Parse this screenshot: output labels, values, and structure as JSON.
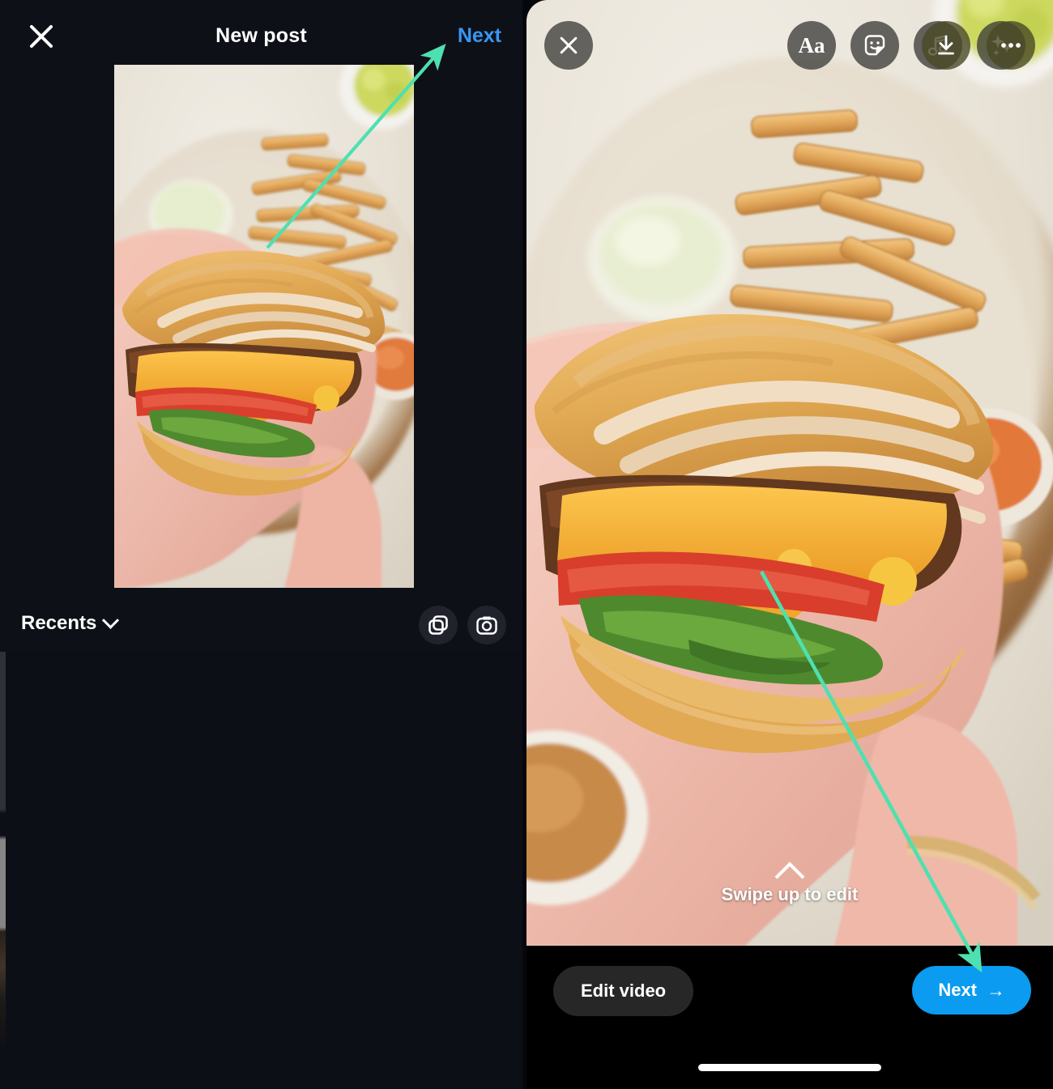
{
  "left_panel": {
    "header": {
      "close_icon": "close-icon",
      "title": "New post",
      "next_label": "Next"
    },
    "gallery": {
      "album_label": "Recents",
      "chevron_icon": "chevron-down-icon",
      "multi_select_icon": "multi-select-icon",
      "camera_icon": "camera-icon"
    }
  },
  "right_panel": {
    "toolbar": {
      "close_icon": "close-icon",
      "text_label": "Aa",
      "text_icon": "text-tool-icon",
      "sticker_icon": "sticker-icon",
      "music_icon": "music-note-icon",
      "effects_icon": "sparkles-icon",
      "download_icon": "download-icon",
      "more_icon": "more-options-icon"
    },
    "overlay": {
      "swipe_chevron_icon": "chevron-up-icon",
      "swipe_hint": "Swipe up to edit"
    },
    "bottom_bar": {
      "edit_video_label": "Edit video",
      "next_label": "Next",
      "next_arrow_icon": "arrow-right-icon",
      "home_indicator": "home-indicator"
    }
  },
  "annotations": {
    "color": "#4ee0b0",
    "arrow_1": "points to Next link in left panel header",
    "arrow_2": "points to Next button in right panel bottom bar"
  },
  "colors": {
    "panel_bg": "#0e1018",
    "accent_blue": "#3897f0",
    "next_button_blue": "#0b9bf0",
    "annotation_green": "#4ee0b0",
    "edit_video_bg": "#272727"
  }
}
